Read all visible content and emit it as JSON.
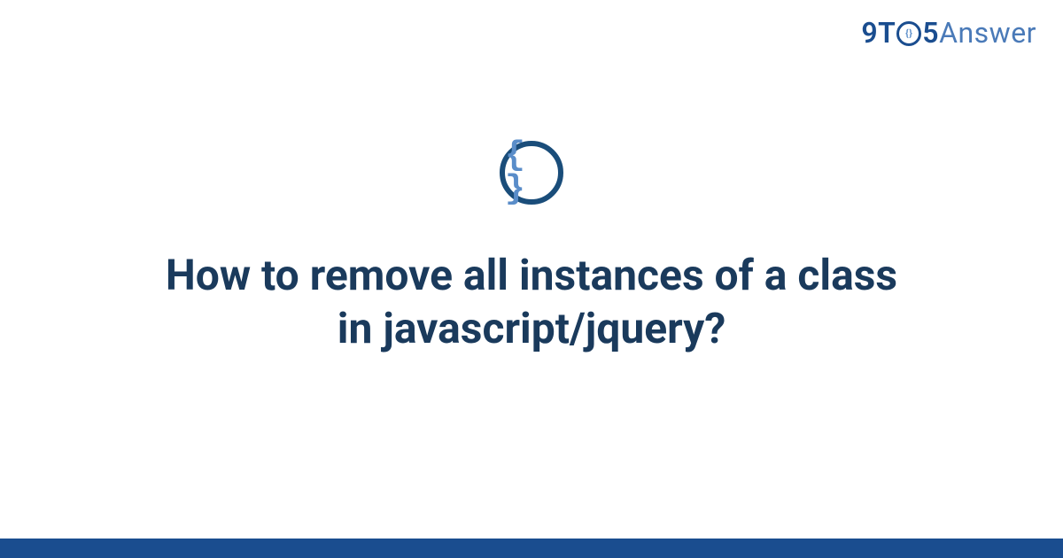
{
  "logo": {
    "part1": "9T",
    "circle_inner": "{}",
    "part2": "5",
    "part3": "Answer"
  },
  "category_icon": {
    "symbol": "{ }",
    "name": "code-braces"
  },
  "title": "How to remove all instances of a class in javascript/jquery?",
  "colors": {
    "primary_dark": "#1a4d8f",
    "primary_light": "#5a8dc9",
    "title_color": "#1a3a5c"
  }
}
